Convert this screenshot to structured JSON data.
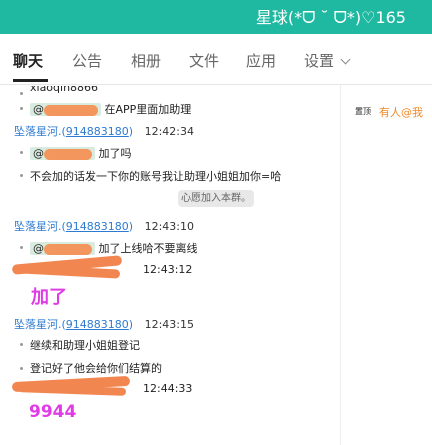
{
  "window": {
    "title": "星球(*ᗜ ˘ ᗜ*)♡165"
  },
  "tabs": [
    {
      "label": "聊天"
    },
    {
      "label": "公告"
    },
    {
      "label": "相册"
    },
    {
      "label": "文件"
    },
    {
      "label": "应用"
    },
    {
      "label": "设置"
    }
  ],
  "chat": {
    "line1": "xiaoqin8866",
    "m1_at": "@",
    "m1_text": "在APP里面加助理",
    "s1_name": "坠落星河.",
    "s1_open": "(",
    "s1_qq": "914883180",
    "s1_close": ")",
    "s1_time": "12:42:34",
    "m2_at": "@",
    "m2_text": "加了吗",
    "m3_text": "不会加的话发一下你的账号我让助理小姐姐加你=哈",
    "system_notice": "心愿加入本群。",
    "s2_name": "坠落星河.",
    "s2_open": "(",
    "s2_qq": "914883180",
    "s2_close": ")",
    "s2_time": "12:43:10",
    "m4_at": "@",
    "m4_text": "加了上线哈不要离线",
    "s3_time": "12:43:12",
    "hand1": "加了",
    "s4_name": "坠落星河.",
    "s4_open": "(",
    "s4_qq": "914883180",
    "s4_close": ")",
    "s4_time": "12:43:15",
    "m5_text": "继续和助理小姐姐登记",
    "m6_text": "登记好了他会给你们结算的",
    "s5_time": "12:44:33",
    "hand2": "9944"
  },
  "right_panel": {
    "pin_text": "置顶",
    "at_me": "有人@我"
  },
  "colors": {
    "titlebar": "#1fb8a0",
    "link": "#2e7bd1",
    "accent": "#f08a2b",
    "handwriting": "#e03ce6",
    "redaction": "#f28650"
  }
}
